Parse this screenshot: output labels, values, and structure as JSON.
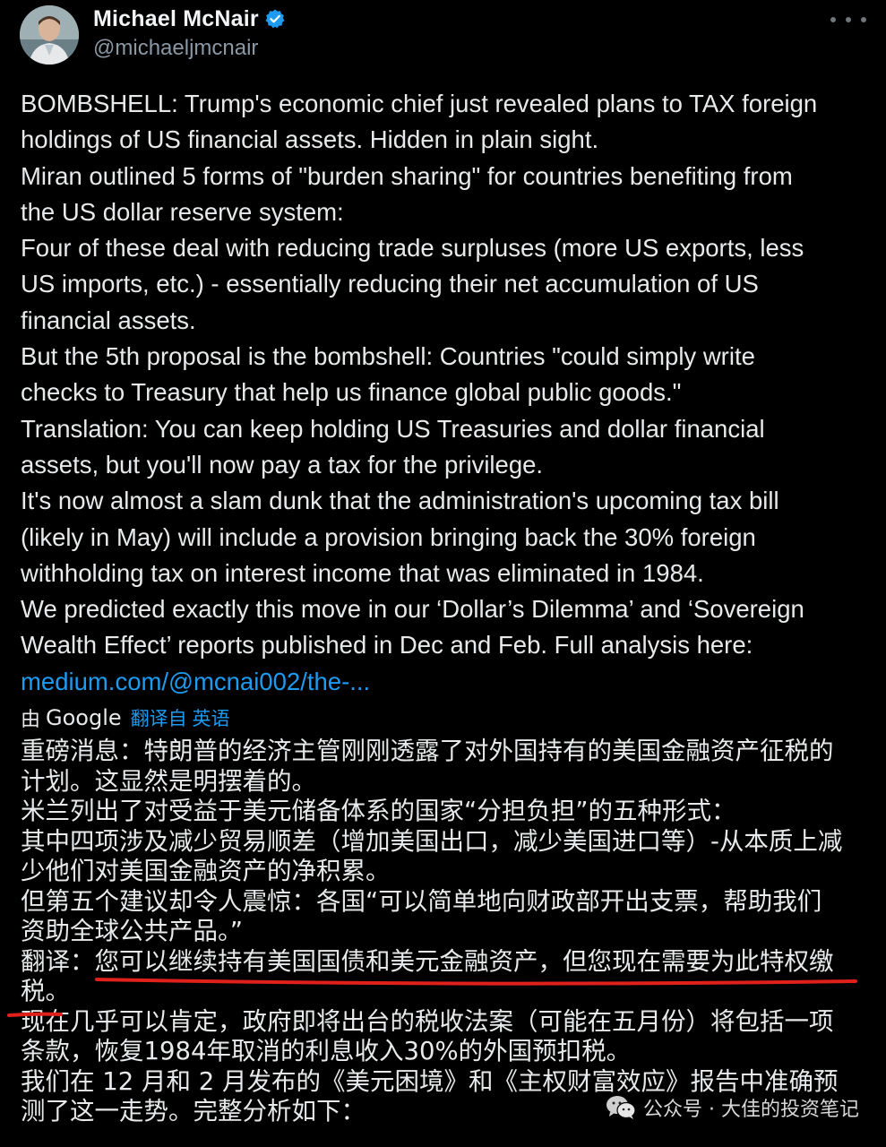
{
  "author": {
    "display_name": "Michael McNair",
    "handle": "@michaeljmcnair",
    "verified": true
  },
  "tweet": {
    "lines": [
      "BOMBSHELL: Trump's economic chief just revealed plans to TAX foreign",
      "holdings of US financial assets. Hidden in plain sight.",
      "Miran outlined 5 forms of \"burden sharing\" for countries benefiting from",
      "the US dollar reserve system:",
      "Four of these deal with reducing trade surpluses (more US exports, less",
      "US imports, etc.) - essentially reducing their net accumulation of US",
      "financial assets.",
      "But the 5th proposal is the bombshell: Countries \"could simply write",
      "checks to Treasury that help us finance global public goods.\"",
      "Translation: You can keep holding US Treasuries and dollar financial",
      "assets, but you'll now pay a tax for the privilege.",
      "It's now almost a slam dunk that the administration's upcoming tax bill",
      "(likely in May) will include a provision bringing back the 30% foreign",
      "withholding tax on interest income that was eliminated in 1984.",
      "We predicted exactly this move in our ‘Dollar’s Dilemma’ and ‘Sovereign",
      "Wealth Effect’ reports published in Dec and Feb. Full analysis here:"
    ],
    "link": "medium.com/@mcnai002/the-..."
  },
  "translation_bar": {
    "by": "由",
    "google": "Google",
    "translated_from": "翻译自 英语"
  },
  "translation": {
    "lines": [
      "重磅消息：特朗普的经济主管刚刚透露了对外国持有的美国金融资产征税的",
      "计划。这显然是明摆着的。",
      "米兰列出了对受益于美元储备体系的国家“分担负担”的五种形式：",
      "其中四项涉及减少贸易顺差（增加美国出口，减少美国进口等）-从本质上减",
      "少他们对美国金融资产的净积累。",
      "但第五个建议却令人震惊：各国“可以简单地向财政部开出支票，帮助我们",
      "资助全球公共产品。”",
      "翻译：您可以继续持有美国国债和美元金融资产，但您现在需要为此特权缴",
      "税。",
      "现在几乎可以肯定，政府即将出台的税收法案（可能在五月份）将包括一项",
      "条款，恢复1984年取消的利息收入30%的外国预扣税。",
      "我们在 12 月和 2 月发布的《美元困境》和《主权财富效应》报告中准确预",
      "测了这一走势。完整分析如下："
    ]
  },
  "watermark": {
    "text": "公众号 · 大佳的投资笔记"
  },
  "colors": {
    "background": "#000000",
    "text": "#e7e9ea",
    "link": "#1d9bf0",
    "handle": "#8b98a5",
    "highlight_underline": "#e0201b",
    "verified_badge": "#1d9bf0"
  }
}
